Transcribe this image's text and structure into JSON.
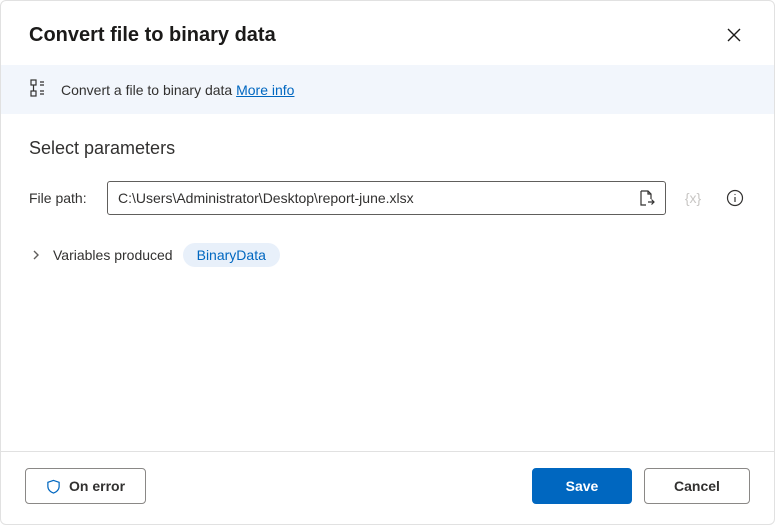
{
  "header": {
    "title": "Convert file to binary data"
  },
  "infoBar": {
    "description": "Convert a file to binary data",
    "moreInfo": "More info"
  },
  "parameters": {
    "sectionTitle": "Select parameters",
    "filePath": {
      "label": "File path:",
      "value": "C:\\Users\\Administrator\\Desktop\\report-june.xlsx"
    },
    "variablesProduced": {
      "label": "Variables produced",
      "chip": "BinaryData"
    }
  },
  "footer": {
    "onError": "On error",
    "save": "Save",
    "cancel": "Cancel"
  },
  "icons": {
    "varToken": "{x}"
  }
}
